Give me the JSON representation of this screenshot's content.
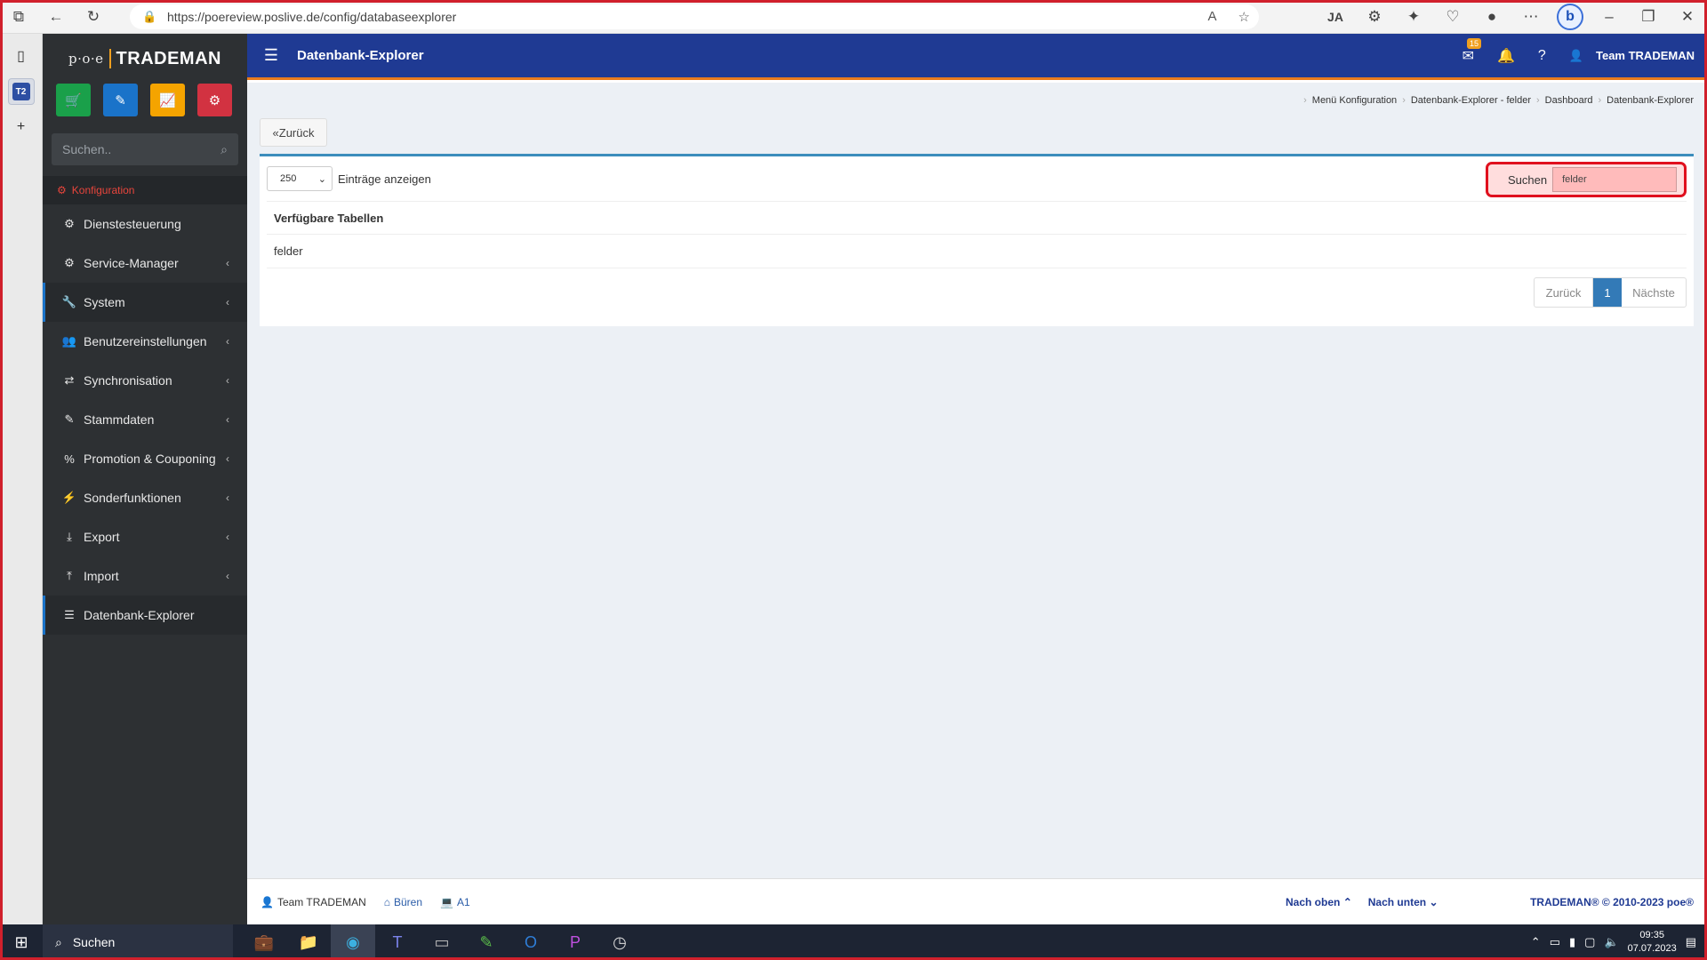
{
  "browser": {
    "url": "https://poereview.poslive.de/config/databaseexplorer",
    "bing_label": "b"
  },
  "tabstrip": {
    "tab_label": "T2"
  },
  "sidebar": {
    "logo_poe": "p·o·e",
    "logo_tm": "TRADEMAN",
    "search_placeholder": "Suchen..",
    "section_label": "Konfiguration",
    "items": [
      {
        "label": "Dienstesteuerung",
        "icon": "gear-icon",
        "glyph": "⚙",
        "chevron": ""
      },
      {
        "label": "Service-Manager",
        "icon": "gears-icon",
        "glyph": "⚙",
        "chevron": "‹"
      },
      {
        "label": "System",
        "icon": "wrench-icon",
        "glyph": "🔧",
        "chevron": "‹"
      },
      {
        "label": "Benutzereinstellungen",
        "icon": "users-icon",
        "glyph": "👥",
        "chevron": "‹"
      },
      {
        "label": "Synchronisation",
        "icon": "shuffle-icon",
        "glyph": "⇄",
        "chevron": "‹"
      },
      {
        "label": "Stammdaten",
        "icon": "pencil-icon",
        "glyph": "✎",
        "chevron": "‹"
      },
      {
        "label": "Promotion & Couponing",
        "icon": "percent-icon",
        "glyph": "%",
        "chevron": "‹"
      },
      {
        "label": "Sonderfunktionen",
        "icon": "bolt-icon",
        "glyph": "⚡",
        "chevron": "‹"
      },
      {
        "label": "Export",
        "icon": "download-icon",
        "glyph": "⤓",
        "chevron": "‹"
      },
      {
        "label": "Import",
        "icon": "upload-icon",
        "glyph": "⤒",
        "chevron": "‹"
      },
      {
        "label": "Datenbank-Explorer",
        "icon": "database-icon",
        "glyph": "☰",
        "chevron": ""
      }
    ]
  },
  "header": {
    "title": "Datenbank-Explorer",
    "mail_count": "15",
    "user_name": "Team TRADEMAN"
  },
  "breadcrumb": [
    "Menü Konfiguration",
    "Datenbank-Explorer - felder",
    "Dashboard",
    "Datenbank-Explorer"
  ],
  "main": {
    "back_label": "Zurück",
    "page_size": "250",
    "entries_label": "Einträge anzeigen",
    "search_label": "Suchen",
    "search_value": "felder",
    "table_header": "Verfügbare Tabellen",
    "rows": [
      "felder"
    ],
    "pager": {
      "prev": "Zurück",
      "current": "1",
      "next": "Nächste"
    }
  },
  "footer": {
    "user": "Team TRADEMAN",
    "location": "Büren",
    "terminal": "A1",
    "nav_up": "Nach oben",
    "nav_down": "Nach unten",
    "copyright": "TRADEMAN® © 2010-2023 poe®"
  },
  "taskbar": {
    "search_label": "Suchen",
    "time": "09:35",
    "date": "07.07.2023"
  },
  "colors": {
    "header": "#1f3a93",
    "accent_orange": "#e87b1e",
    "sidebar": "#2d3033",
    "highlight_red": "#e0101e"
  }
}
